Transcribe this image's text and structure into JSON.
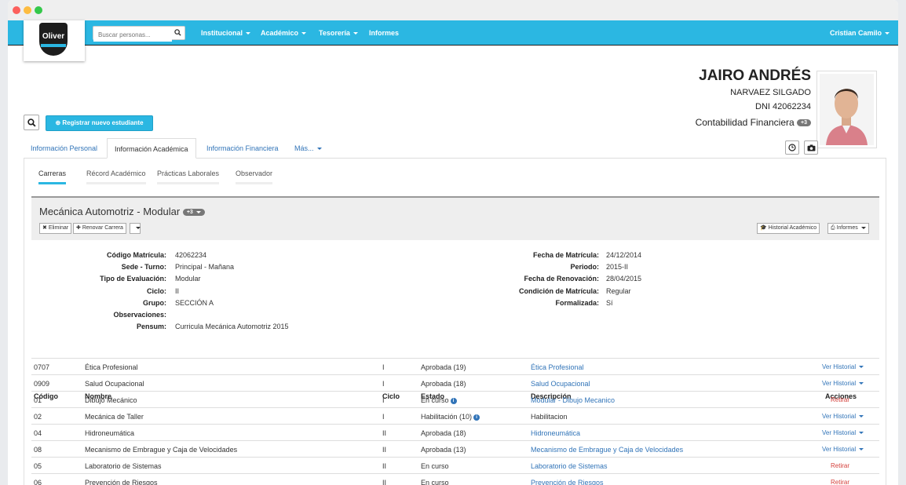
{
  "app": {
    "logo_text": "Oliver",
    "colors": {
      "accent": "#2bb7e2",
      "link": "#3174b8",
      "danger": "#d43f3a"
    }
  },
  "navbar": {
    "search_placeholder": "Buscar personas...",
    "items": [
      "Institucional",
      "Académico",
      "Tesorería",
      "Informes"
    ],
    "user": "Cristian Camilo"
  },
  "student": {
    "name": "JAIRO ANDRÉS",
    "surname": "NARVAEZ SILGADO",
    "dni": "DNI 42062234",
    "program": "Contabilidad Financiera",
    "program_badge": "+3"
  },
  "actions": {
    "register_label": "Registrar nuevo estudiante"
  },
  "tabs": [
    "Información Personal",
    "Información Académica",
    "Información Financiera",
    "Más..."
  ],
  "subtabs": [
    "Carreras",
    "Récord Académico",
    "Prácticas Laborales",
    "Observador"
  ],
  "career": {
    "title": "Mecánica Automotriz - Modular",
    "badge": "+3",
    "delete_label": "Eliminar",
    "renew_label": "Renovar Carrera",
    "history_label": "Historial Académico",
    "reports_label": "Informes"
  },
  "details_left": [
    {
      "label": "Código Matrícula:",
      "value": "42062234"
    },
    {
      "label": "Sede - Turno:",
      "value": "Principal - Mañana"
    },
    {
      "label": "Tipo de Evaluación:",
      "value": "Modular"
    },
    {
      "label": "Ciclo:",
      "value": "II"
    },
    {
      "label": "Grupo:",
      "value": "SECCIÓN A"
    },
    {
      "label": "Observaciones:",
      "value": ""
    },
    {
      "label": "Pensum:",
      "value": "Curricula Mecánica Automotriz 2015"
    }
  ],
  "details_right": [
    {
      "label": "Fecha de Matrícula:",
      "value": "24/12/2014"
    },
    {
      "label": "Periodo:",
      "value": "2015-II"
    },
    {
      "label": "Fecha de Renovación:",
      "value": "28/04/2015"
    },
    {
      "label": "Condición de Matrícula:",
      "value": "Regular"
    },
    {
      "label": "Formalizada:",
      "value": "Sí"
    }
  ],
  "table": {
    "headers": [
      "Código",
      "Nombre",
      "Ciclo",
      "Estado",
      "Descripción",
      "Acciones"
    ],
    "rows": [
      {
        "code": "0707",
        "name": "Ética Profesional",
        "cycle": "I",
        "status": "Aprobada (19)",
        "description": "Ética Profesional",
        "action": "Ver Historial"
      },
      {
        "code": "0909",
        "name": "Salud Ocupacional",
        "cycle": "I",
        "status": "Aprobada (18)",
        "description": "Salud Ocupacional",
        "action": "Ver Historial"
      },
      {
        "code": "01",
        "name": "Dibujo Mecánico",
        "cycle": "I",
        "status": "En curso",
        "description": "Modular - Dibujo Mecanico",
        "action": "Retirar"
      },
      {
        "code": "02",
        "name": "Mecánica de Taller",
        "cycle": "I",
        "status": "Habilitación (10)",
        "description": "Habilitacion",
        "action": "Ver Historial"
      },
      {
        "code": "04",
        "name": "Hidroneumática",
        "cycle": "II",
        "status": "Aprobada (18)",
        "description": "Hidroneumática",
        "action": "Ver Historial"
      },
      {
        "code": "08",
        "name": "Mecanismo de Embrague y Caja de Velocidades",
        "cycle": "II",
        "status": "Aprobada (13)",
        "description": "Mecanismo de Embrague y Caja de Velocidades",
        "action": "Ver Historial"
      },
      {
        "code": "05",
        "name": "Laboratorio de Sistemas",
        "cycle": "II",
        "status": "En curso",
        "description": "Laboratorio de Sistemas",
        "action": "Retirar"
      },
      {
        "code": "06",
        "name": "Prevención de Riesgos",
        "cycle": "II",
        "status": "En curso",
        "description": "Prevención de Riesgos",
        "action": "Retirar"
      }
    ]
  }
}
